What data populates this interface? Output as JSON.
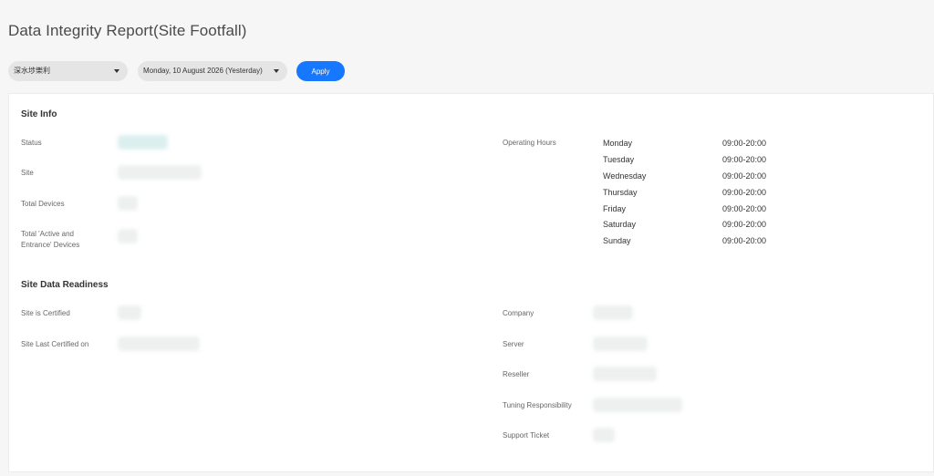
{
  "header": {
    "title": "Data Integrity Report(Site Footfall)"
  },
  "toolbar": {
    "site_value": "深水埗樂利",
    "date_value": "Monday, 10 August 2026 (Yesterday)",
    "apply_label": "Apply"
  },
  "site_info": {
    "title": "Site Info",
    "labels": {
      "status": "Status",
      "site": "Site",
      "total_devices": "Total Devices",
      "active_entrance_line1": "Total 'Active and",
      "active_entrance_line2": "Entrance' Devices",
      "operating_hours": "Operating Hours"
    },
    "operating_hours": [
      {
        "day": "Monday",
        "hours": "09:00-20:00"
      },
      {
        "day": "Tuesday",
        "hours": "09:00-20:00"
      },
      {
        "day": "Wednesday",
        "hours": "09:00-20:00"
      },
      {
        "day": "Thursday",
        "hours": "09:00-20:00"
      },
      {
        "day": "Friday",
        "hours": "09:00-20:00"
      },
      {
        "day": "Saturday",
        "hours": "09:00-20:00"
      },
      {
        "day": "Sunday",
        "hours": "09:00-20:00"
      }
    ]
  },
  "readiness": {
    "title": "Site Data Readiness",
    "labels": {
      "certified": "Site is Certified",
      "last_certified": "Site Last Certified on",
      "company": "Company",
      "server": "Server",
      "reseller": "Reseller",
      "tuning": "Tuning Responsibility",
      "support_ticket": "Support Ticket"
    }
  },
  "colors": {
    "accent": "#1677ff",
    "page_bg": "#f6f6f6",
    "panel_bg": "#ffffff"
  }
}
